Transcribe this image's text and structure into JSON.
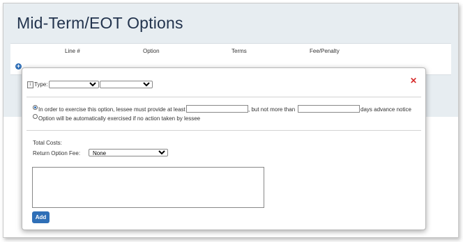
{
  "page": {
    "title": "Mid-Term/EOT Options"
  },
  "grid": {
    "columns": [
      "Line #",
      "Option",
      "Terms",
      "Fee/Penalty"
    ],
    "add_icon_glyph": "+"
  },
  "modal": {
    "close_glyph": "✕",
    "info_glyph": "i",
    "type_label": "Type:",
    "type_select_1": "",
    "type_select_2": "",
    "option1": {
      "text_a": "In order to exercise this option, lessee must provide at least",
      "input_min": "",
      "text_b": ", but not more than",
      "input_max": "",
      "text_c": "days advance notice",
      "selected": true
    },
    "option2": {
      "text": "Option will be automatically exercised if no action taken by lessee",
      "selected": false
    },
    "total_costs_label": "Total Costs:",
    "return_fee_label": "Return Option Fee:",
    "return_fee_value": "None",
    "notes_value": "",
    "add_button": "Add"
  },
  "icons": {
    "add": "plus-circle-icon",
    "close": "close-icon",
    "info": "info-icon"
  },
  "colors": {
    "accent": "#2f6fb7",
    "close": "#d62a2a",
    "title": "#22334d",
    "header_band": "#e7edf1"
  }
}
